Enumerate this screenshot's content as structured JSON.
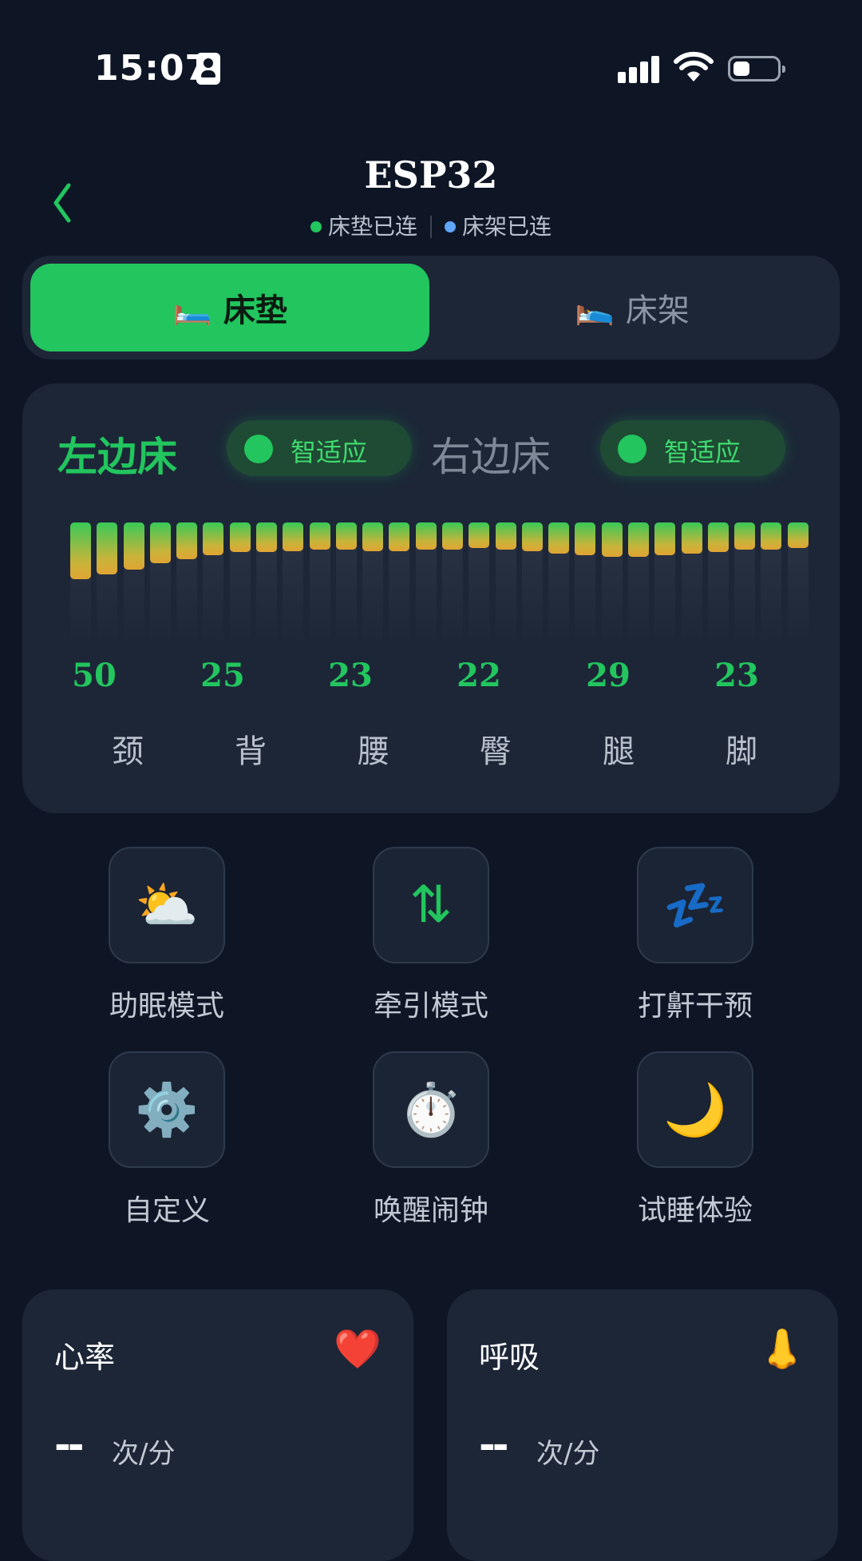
{
  "status_bar": {
    "time": "15:07"
  },
  "header": {
    "title": "ESP32",
    "mattress_status": "床垫已连",
    "frame_status": "床架已连",
    "mattress_status_color": "#22c55e",
    "frame_status_color": "#60a5fa"
  },
  "tabs": [
    {
      "label": "床垫",
      "icon": "bed-icon",
      "active": true
    },
    {
      "label": "床架",
      "icon": "bed-frame-icon",
      "active": false
    }
  ],
  "mattress": {
    "left_label": "左边床",
    "right_label": "右边床",
    "left_mode": "智适应",
    "right_mode": "智适应",
    "bar_levels": [
      0.42,
      0.38,
      0.35,
      0.3,
      0.27,
      0.24,
      0.22,
      0.22,
      0.21,
      0.2,
      0.2,
      0.21,
      0.21,
      0.2,
      0.2,
      0.19,
      0.2,
      0.21,
      0.23,
      0.24,
      0.25,
      0.25,
      0.24,
      0.23,
      0.22,
      0.2,
      0.2,
      0.19
    ],
    "zones": [
      {
        "value": "50",
        "label": "颈"
      },
      {
        "value": "25",
        "label": "背"
      },
      {
        "value": "23",
        "label": "腰"
      },
      {
        "value": "22",
        "label": "臀"
      },
      {
        "value": "29",
        "label": "腿"
      },
      {
        "value": "23",
        "label": "脚"
      }
    ]
  },
  "functions": [
    {
      "label": "助眠模式",
      "emoji": "⛅",
      "icon": "sun-cloud-icon"
    },
    {
      "label": "牵引模式",
      "emoji": "⇅",
      "icon": "up-down-arrows-icon"
    },
    {
      "label": "打鼾干预",
      "emoji": "💤",
      "icon": "snore-zzz-icon"
    },
    {
      "label": "自定义",
      "emoji": "⚙️",
      "icon": "gear-icon"
    },
    {
      "label": "唤醒闹钟",
      "emoji": "⏱️",
      "icon": "stopwatch-icon"
    },
    {
      "label": "试睡体验",
      "emoji": "🌙",
      "icon": "moon-icon"
    }
  ],
  "metrics": [
    {
      "title": "心率",
      "value": "--",
      "unit": "次/分",
      "emoji": "❤️",
      "icon": "heart-icon"
    },
    {
      "title": "呼吸",
      "value": "--",
      "unit": "次/分",
      "emoji": "👃",
      "icon": "nose-icon"
    }
  ]
}
